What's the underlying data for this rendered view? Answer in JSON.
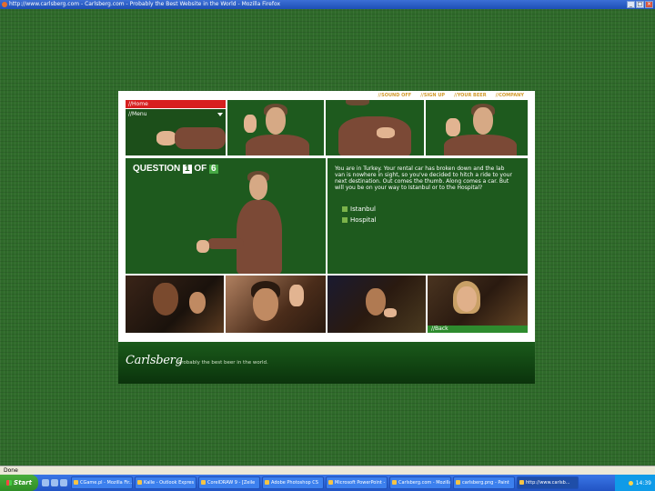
{
  "window": {
    "title": "http://www.carlsberg.com - Carlsberg.com - Probably the Best Website in the World - Mozilla Firefox"
  },
  "site": {
    "topnav": [
      "//SOUND OFF",
      "//SIGN UP",
      "//YOUR BEER",
      "//COMPANY"
    ],
    "menu": {
      "home": "//Home",
      "menu": "//Menu"
    },
    "question": {
      "label": "QUESTION",
      "current": "1",
      "of_label": "OF",
      "total": "6"
    },
    "scenario": "You are in Turkey. Your rental car has broken down and the lab van is nowhere in sight, so you've decided to hitch a ride to your next destination. Out comes the thumb. Along comes a car. But will you be on your way to Istanbul or to the Hospital?",
    "options": [
      "Istanbul",
      "Hospital"
    ],
    "back": "//Back",
    "footer": {
      "logo": "Carlsberg",
      "tagline": "Probably the best beer in the world."
    }
  },
  "statusbar": {
    "text": "Done"
  },
  "taskbar": {
    "start": "Start",
    "tasks": [
      "CGame.pl - Mozilla Fir...",
      "Kalle - Outlook Expres",
      "CorelDRAW 9 - [Zeile",
      "Adobe Photoshop CS",
      "Microsoft PowerPoint -",
      "Carlsberg.com - Mozilla",
      "carlsberg.png - Paint",
      "http://www.carlsb..."
    ],
    "clock": "14:39"
  },
  "colors": {
    "desktop": "#2f6a2a",
    "site_green": "#1e5a1e",
    "home_red": "#d71f1f",
    "nav_orange": "#d29a2a"
  }
}
